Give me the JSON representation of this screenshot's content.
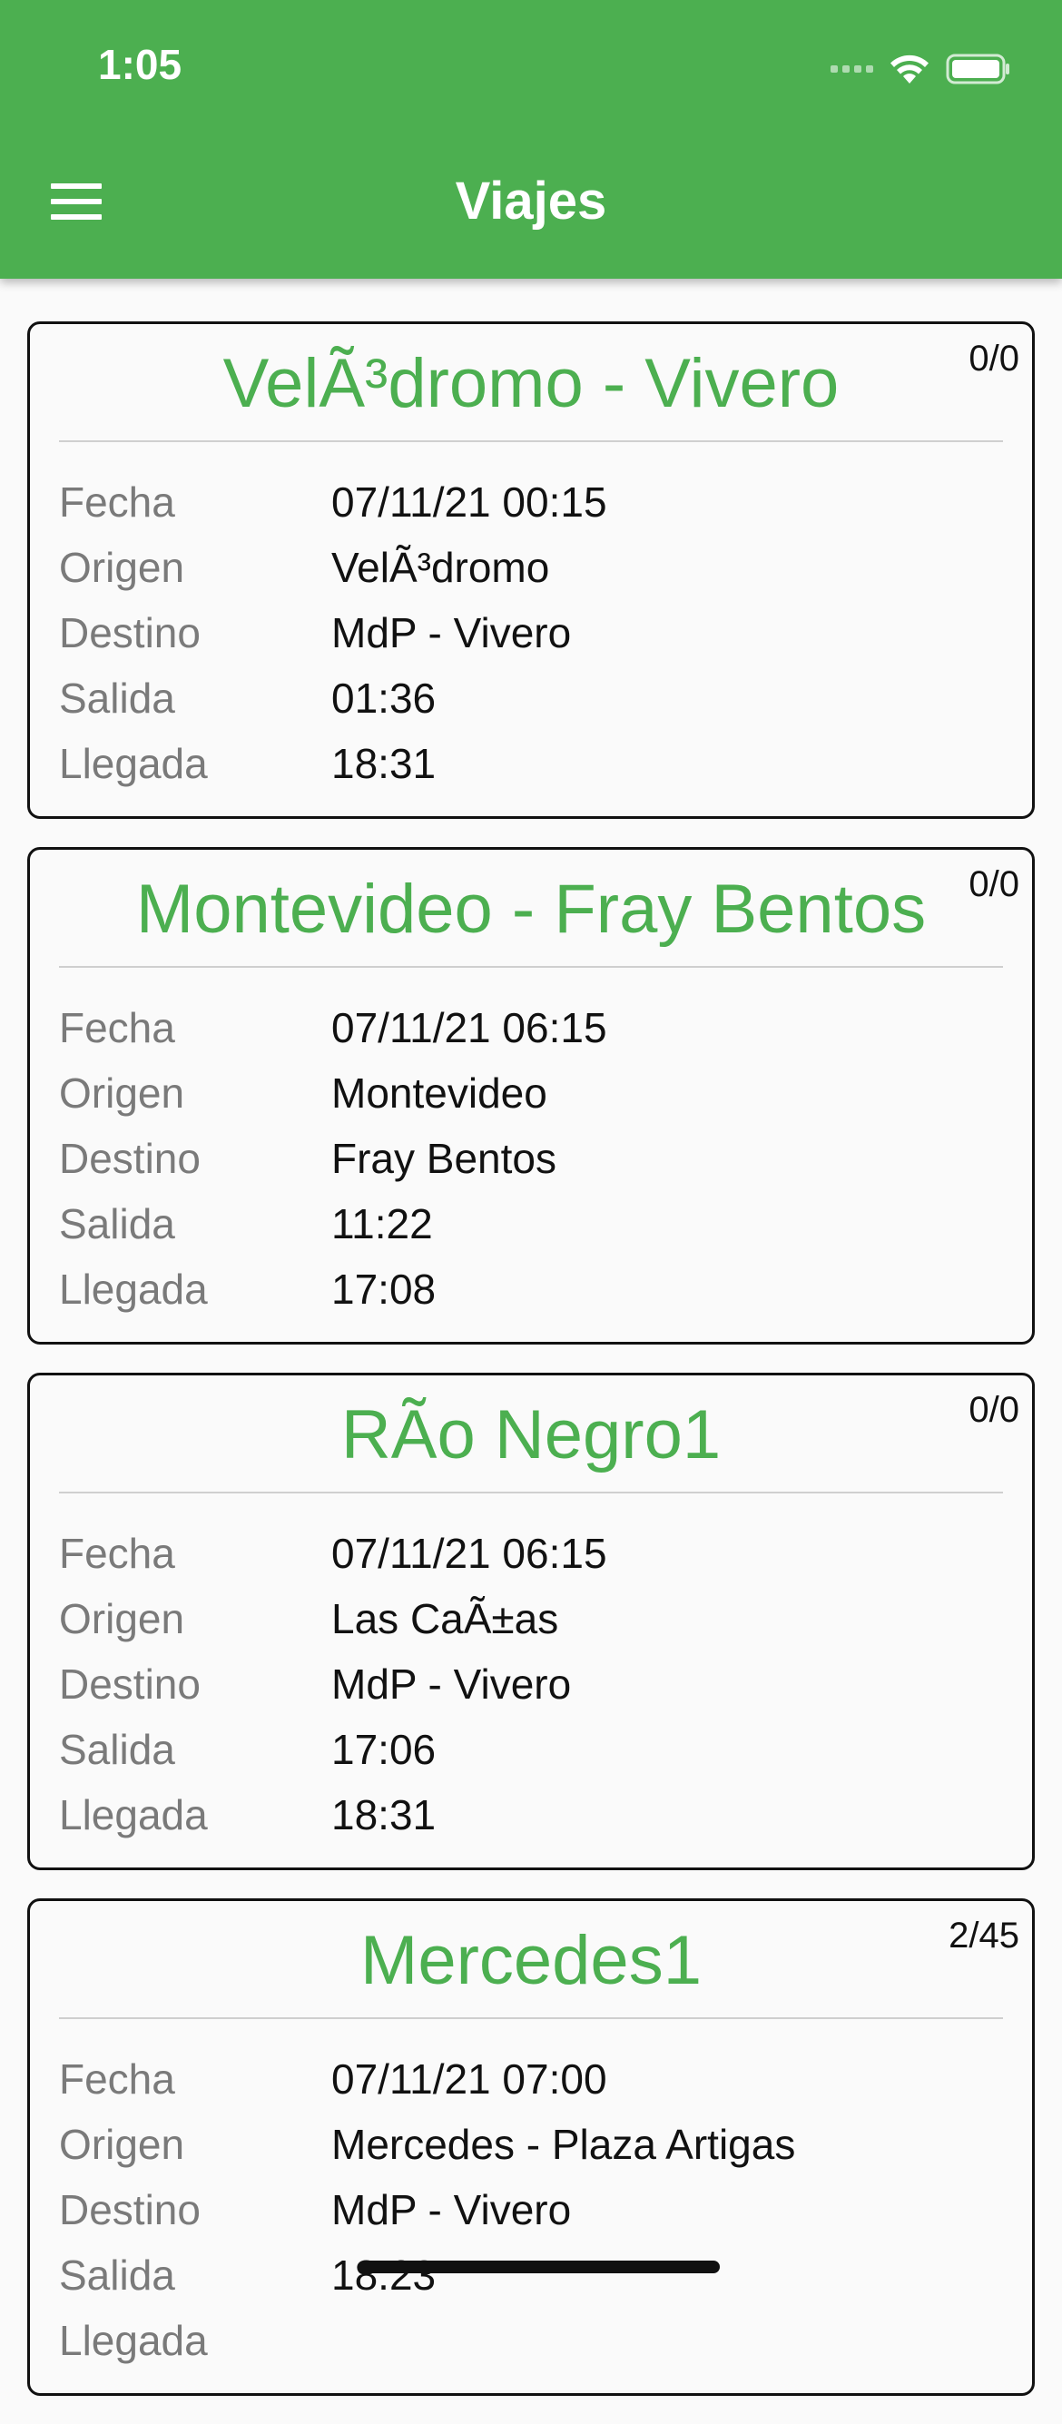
{
  "status_bar": {
    "time": "1:05",
    "icons": [
      "signal-icon",
      "wifi-icon",
      "battery-icon"
    ]
  },
  "app_bar": {
    "title": "Viajes",
    "menu_icon": "menu-icon",
    "color": "#4caf50"
  },
  "field_labels": {
    "fecha": "Fecha",
    "origen": "Origen",
    "destino": "Destino",
    "salida": "Salida",
    "llegada": "Llegada"
  },
  "trips": [
    {
      "title": "VelÃ³dromo - Vivero",
      "count": "0/0",
      "fecha": "07/11/21 00:15",
      "origen": "VelÃ³dromo",
      "destino": "MdP - Vivero",
      "salida": "01:36",
      "llegada": "18:31"
    },
    {
      "title": "Montevideo - Fray Bentos",
      "count": "0/0",
      "fecha": "07/11/21 06:15",
      "origen": "Montevideo",
      "destino": "Fray Bentos",
      "salida": "11:22",
      "llegada": "17:08"
    },
    {
      "title": "RÃo Negro1",
      "count": "0/0",
      "fecha": "07/11/21 06:15",
      "origen": "Las CaÃ±as",
      "destino": "MdP - Vivero",
      "salida": "17:06",
      "llegada": "18:31"
    },
    {
      "title": "Mercedes1",
      "count": "2/45",
      "fecha": "07/11/21 07:00",
      "origen": "Mercedes - Plaza Artigas",
      "destino": "MdP - Vivero",
      "salida": "18:23",
      "llegada": ""
    }
  ]
}
